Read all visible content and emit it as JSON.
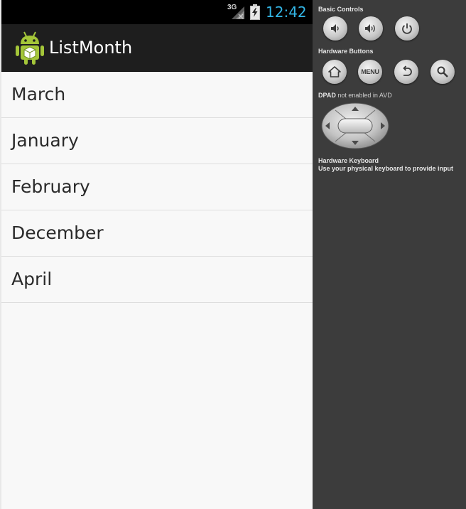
{
  "status_bar": {
    "network": "3G",
    "time": "12:42",
    "icons": [
      "signal-icon",
      "battery-charging-icon"
    ]
  },
  "action_bar": {
    "title": "ListMonth",
    "icon": "android-app-icon"
  },
  "months": [
    "March",
    "January",
    "February",
    "December",
    "April"
  ],
  "controls": {
    "basic_label": "Basic Controls",
    "basic_buttons": [
      "volume-down-icon",
      "volume-up-icon",
      "power-icon"
    ],
    "hardware_label": "Hardware Buttons",
    "hardware_buttons": [
      "home-icon",
      "menu",
      "back-icon",
      "search-icon"
    ],
    "menu_label": "MENU",
    "dpad_label_bold": "DPAD",
    "dpad_label_rest": "not enabled in AVD",
    "keyboard_label": "Hardware Keyboard",
    "keyboard_hint": "Use your physical keyboard to provide input"
  },
  "colors": {
    "clock": "#33b5e5",
    "action_bar": "#1e1e1e",
    "list_bg": "#f8f8f8",
    "panel_bg": "#3c3c3c",
    "android_green": "#a4c639"
  }
}
